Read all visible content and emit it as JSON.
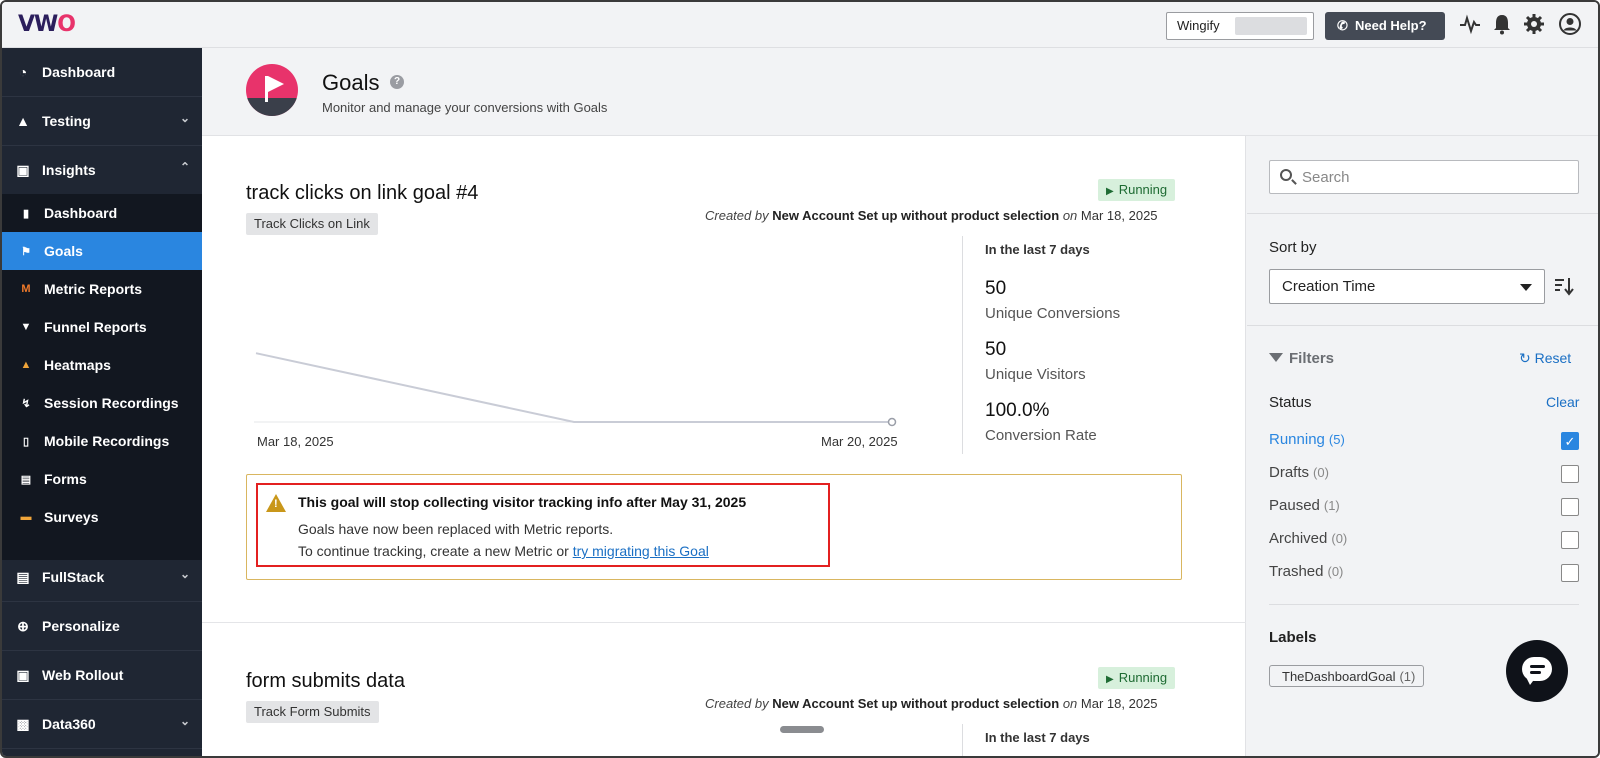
{
  "topbar": {
    "logo_v": "VW",
    "logo_o": "O",
    "account_name": "Wingify",
    "help_label": "Need Help?",
    "icons": [
      "activity-icon",
      "bell-icon",
      "gear-icon",
      "user-icon"
    ]
  },
  "sidebar": {
    "main_items": [
      {
        "label": "Dashboard",
        "icon": "dashboard-icon"
      },
      {
        "label": "Testing",
        "icon": "flask-icon"
      },
      {
        "label": "Insights",
        "icon": "insights-icon"
      },
      {
        "label": "FullStack",
        "icon": "stack-icon"
      },
      {
        "label": "Personalize",
        "icon": "target-icon"
      },
      {
        "label": "Web Rollout",
        "icon": "rollout-icon"
      },
      {
        "label": "Data360",
        "icon": "data-icon"
      }
    ],
    "insights_items": [
      {
        "label": "Dashboard",
        "icon": "bar-chart-icon"
      },
      {
        "label": "Goals",
        "icon": "goal-flag-icon",
        "active": true
      },
      {
        "label": "Metric Reports",
        "icon": "metric-icon"
      },
      {
        "label": "Funnel Reports",
        "icon": "funnel-icon"
      },
      {
        "label": "Heatmaps",
        "icon": "flame-icon"
      },
      {
        "label": "Session Recordings",
        "icon": "recording-icon"
      },
      {
        "label": "Mobile Recordings",
        "icon": "mobile-icon"
      },
      {
        "label": "Forms",
        "icon": "form-icon"
      },
      {
        "label": "Surveys",
        "icon": "survey-icon"
      }
    ]
  },
  "header": {
    "title": "Goals",
    "subtitle": "Monitor and manage your conversions with Goals"
  },
  "goals": [
    {
      "title": "track clicks on link goal #4",
      "status": "Running",
      "type": "Track Clicks on Link",
      "created_prefix": "Created by",
      "creator": "New Account Set up without product selection",
      "on_word": "on",
      "date": "Mar 18, 2025",
      "stats_period": "In the last 7 days",
      "unique_conversions": "50",
      "unique_conversions_label": "Unique Conversions",
      "unique_visitors": "50",
      "unique_visitors_label": "Unique Visitors",
      "conversion_rate": "100.0%",
      "conversion_rate_label": "Conversion Rate",
      "warning_title": "This goal will stop collecting visitor tracking info after May 31, 2025",
      "warning_line1": "Goals have now been replaced with Metric reports.",
      "warning_line2": "To continue tracking, create a new Metric or",
      "warning_link": "try migrating this Goal"
    },
    {
      "title": "form submits data",
      "status": "Running",
      "type": "Track Form Submits",
      "created_prefix": "Created by",
      "creator": "New Account Set up without product selection",
      "on_word": "on",
      "date": "Mar 18, 2025",
      "stats_period": "In the last 7 days"
    }
  ],
  "chart_data": {
    "type": "line",
    "x": [
      "Mar 18, 2025",
      "Mar 19, 2025",
      "Mar 20, 2025"
    ],
    "x_tick_labels": [
      "Mar 18, 2025",
      "Mar 20, 2025"
    ],
    "series": [
      {
        "values": [
          2,
          0,
          0
        ]
      }
    ],
    "ylim": [
      0,
      2.5
    ],
    "grid": false,
    "color": "#c9ccd6"
  },
  "filters": {
    "search_placeholder": "Search",
    "sort_by_label": "Sort by",
    "sort_value": "Creation Time",
    "filters_label": "Filters",
    "reset_label": "Reset",
    "status_label": "Status",
    "clear_label": "Clear",
    "statuses": [
      {
        "name": "Running",
        "count": "(5)",
        "checked": true
      },
      {
        "name": "Drafts",
        "count": "(0)",
        "checked": false
      },
      {
        "name": "Paused",
        "count": "(1)",
        "checked": false
      },
      {
        "name": "Archived",
        "count": "(0)",
        "checked": false
      },
      {
        "name": "Trashed",
        "count": "(0)",
        "checked": false
      }
    ],
    "labels_label": "Labels",
    "labels": [
      {
        "name": "TheDashboardGoal",
        "count": "(1)"
      }
    ]
  },
  "colors": {
    "accent": "#2a86e0",
    "sidebar_bg": "#1f2633",
    "brand_pink": "#e8336b",
    "running_bg": "#d7f0dc",
    "warning_border": "#d9b660",
    "highlight_red": "#e32020"
  }
}
